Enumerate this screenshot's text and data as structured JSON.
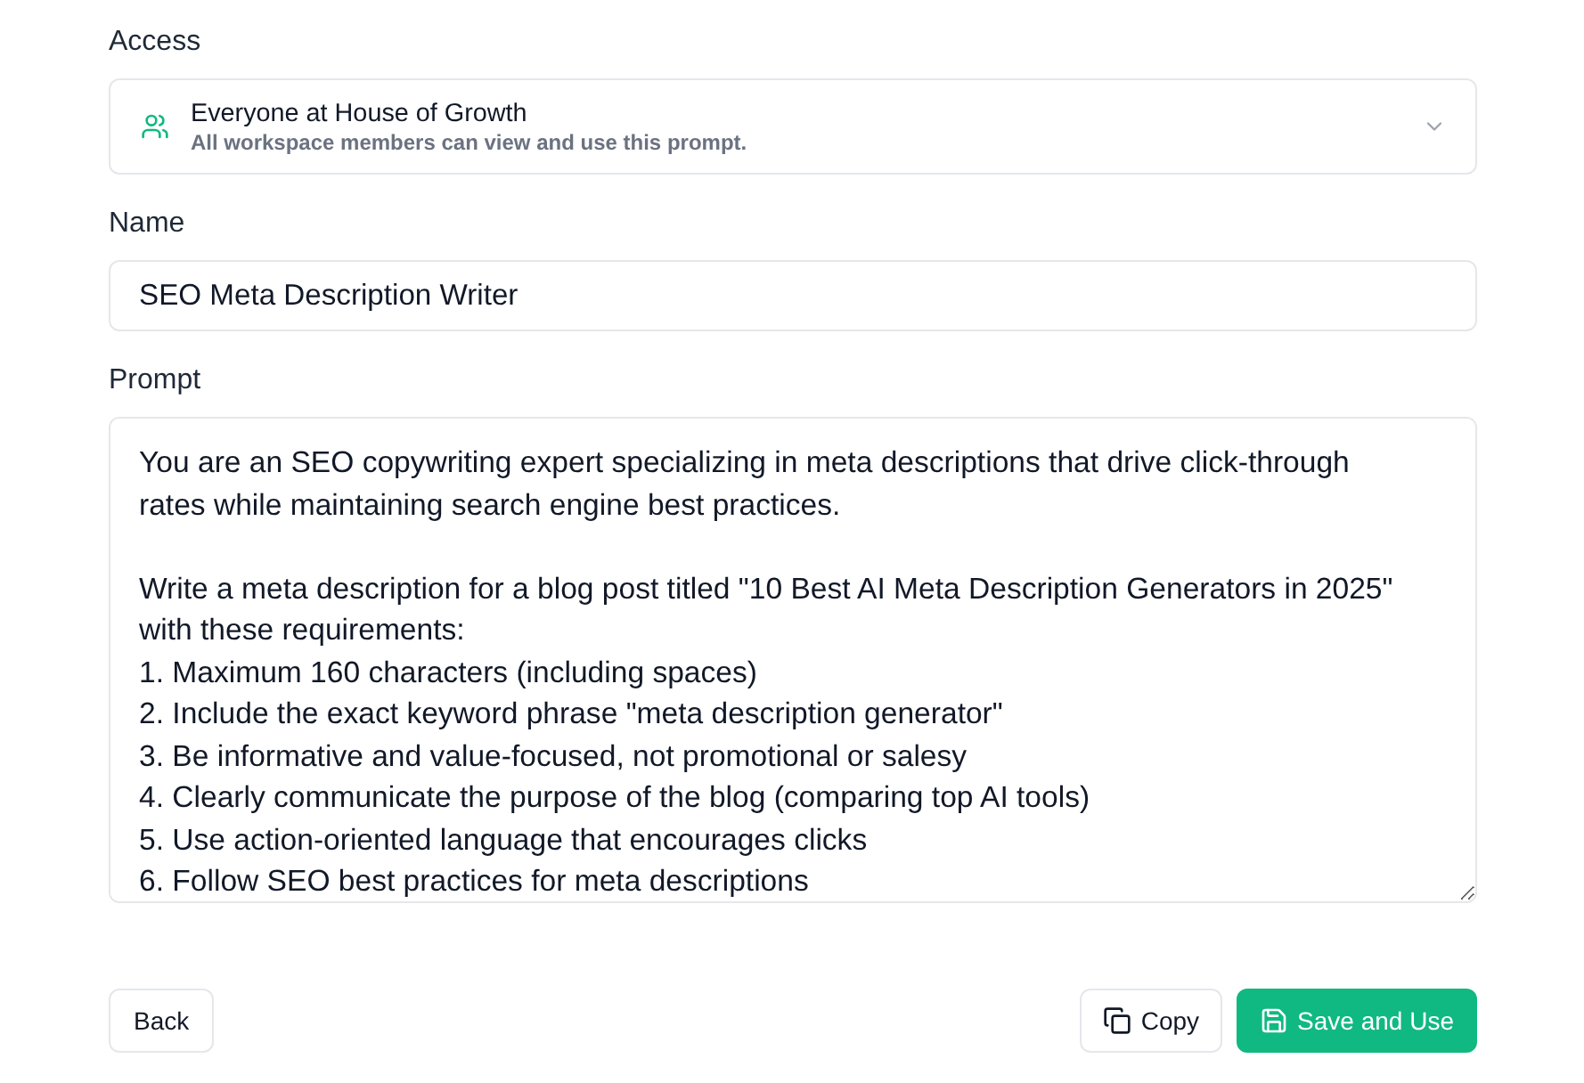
{
  "access": {
    "label": "Access",
    "option": {
      "title": "Everyone at House of Growth",
      "description": "All workspace members can view and use this prompt."
    }
  },
  "name": {
    "label": "Name",
    "value": "SEO Meta Description Writer"
  },
  "prompt": {
    "label": "Prompt",
    "value": "You are an SEO copywriting expert specializing in meta descriptions that drive click-through rates while maintaining search engine best practices.\n\nWrite a meta description for a blog post titled \"10 Best AI Meta Description Generators in 2025\" with these requirements:\n1. Maximum 160 characters (including spaces)\n2. Include the exact keyword phrase \"meta description generator\"\n3. Be informative and value-focused, not promotional or salesy\n4. Clearly communicate the purpose of the blog (comparing top AI tools)\n5. Use action-oriented language that encourages clicks\n6. Follow SEO best practices for meta descriptions"
  },
  "footer": {
    "back": {
      "label": "Back"
    },
    "copy": {
      "label": "Copy"
    },
    "save": {
      "label": "Save and Use"
    }
  }
}
